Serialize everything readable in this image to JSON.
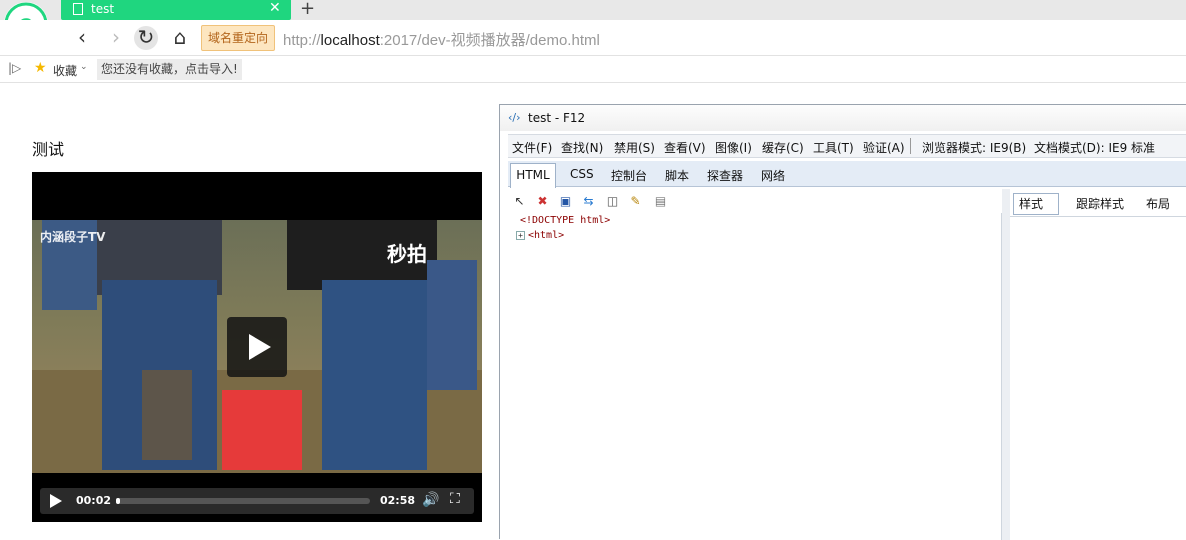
{
  "browser": {
    "tab_title": "test",
    "tab_close": "✕",
    "new_tab": "+",
    "back": "‹",
    "forward": "›",
    "reload": "↻",
    "home": "⌂",
    "redirect_badge": "域名重定向",
    "url_scheme": "http://",
    "url_host": "localhost",
    "url_rest": ":2017/dev-视频播放器/demo.html",
    "sidebar_toggle": "|▷",
    "favorites_label": "收藏",
    "favorites_dropdown": "⌄",
    "import_hint": "您还没有收藏，点击导入!"
  },
  "page": {
    "heading": "测试",
    "video": {
      "watermark_left": "内涵段子TV",
      "watermark_right": "秒拍",
      "time_current": "00:02",
      "time_total": "02:58",
      "progress_fraction": 0.012
    }
  },
  "devtools": {
    "title": "test - F12",
    "menus": [
      "文件(F)",
      "查找(N)",
      "禁用(S)",
      "查看(V)",
      "图像(I)",
      "缓存(C)",
      "工具(T)",
      "验证(A)",
      "浏览器模式: IE9(B)",
      "文档模式(D): IE9 标准"
    ],
    "tabs": [
      "HTML",
      "CSS",
      "控制台",
      "脚本",
      "探查器",
      "网络"
    ],
    "tree": {
      "doctype": "<!DOCTYPE html>",
      "expander": "+",
      "html_node": "<html>"
    },
    "right_tabs": [
      "样式",
      "跟踪样式",
      "布局"
    ]
  },
  "icons": {
    "logo": "browser-e-logo",
    "star": "star-icon",
    "devtools": "f12-icon"
  },
  "colors": {
    "tab_active": "#1fd67f",
    "redirect_bg": "#fde6c0",
    "devtools_tab_bg": "#e4ecf6"
  }
}
